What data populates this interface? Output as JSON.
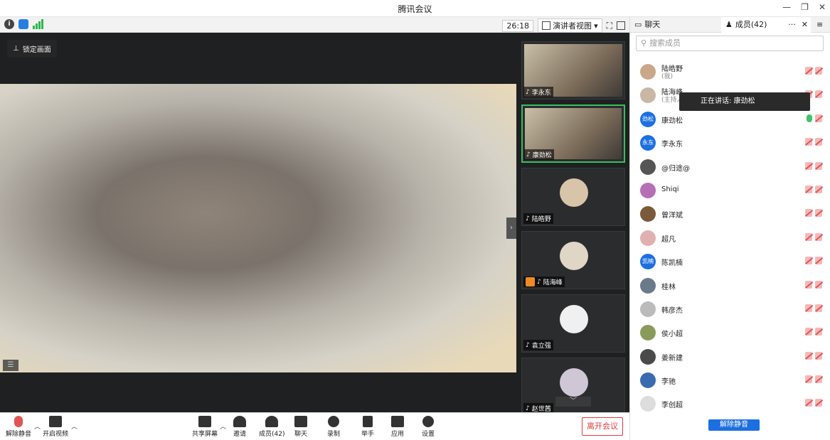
{
  "window": {
    "title": "腾讯会议"
  },
  "toolbar": {
    "timer": "26:18",
    "view_label": "演讲者视图"
  },
  "main": {
    "lock_label": "锁定画面"
  },
  "thumbnails": [
    {
      "name": "李永东",
      "type": "camera",
      "mic": "muted"
    },
    {
      "name": "康劲松",
      "type": "camera",
      "mic": "on",
      "active": true
    },
    {
      "name": "陆皓野",
      "type": "avatar",
      "mic": "muted"
    },
    {
      "name": "陆海峰",
      "type": "avatar",
      "mic": "muted",
      "host": true
    },
    {
      "name": "袁立强",
      "type": "avatar",
      "mic": "muted"
    },
    {
      "name": "赵世茜",
      "type": "avatar",
      "mic": "muted"
    }
  ],
  "bottombar": {
    "unmute": "解除静音",
    "start_video": "开启视频",
    "share_screen": "共享屏幕",
    "invite": "邀请",
    "members": "成员(42)",
    "chat": "聊天",
    "record": "录制",
    "raise_hand": "举手",
    "apps": "应用",
    "settings": "设置",
    "leave": "离开会议"
  },
  "panel": {
    "tab_chat": "聊天",
    "tab_members": "成员(42)",
    "search_placeholder": "搜索成员",
    "speaking_tooltip": "正在讲话: 康劲松",
    "unmute_button": "解除静音",
    "members": [
      {
        "name": "陆皓野",
        "sub": "(我)",
        "avatar": "",
        "color": "#c9a88a"
      },
      {
        "name": "陆海峰",
        "sub": "(主持人",
        "avatar": "",
        "color": "#c8b7a4"
      },
      {
        "name": "康劲松",
        "sub": "",
        "avatar": "劲松",
        "color": "#1c6fe0",
        "mic": "on"
      },
      {
        "name": "李永东",
        "sub": "",
        "avatar": "永东",
        "color": "#1c6fe0"
      },
      {
        "name": "@归途@",
        "sub": "",
        "avatar": "",
        "color": "#555"
      },
      {
        "name": "Shiqi",
        "sub": "",
        "avatar": "",
        "color": "#b56fb5"
      },
      {
        "name": "曾洋斌",
        "sub": "",
        "avatar": "",
        "color": "#7a5a3a"
      },
      {
        "name": "超凡",
        "sub": "",
        "avatar": "",
        "color": "#e0b0b0"
      },
      {
        "name": "陈凯楠",
        "sub": "",
        "avatar": "凯楠",
        "color": "#1c6fe0"
      },
      {
        "name": "桂林",
        "sub": "",
        "avatar": "",
        "color": "#6a7a8a"
      },
      {
        "name": "韩彦杰",
        "sub": "",
        "avatar": "",
        "color": "#bbb"
      },
      {
        "name": "侯小超",
        "sub": "",
        "avatar": "",
        "color": "#8a9a5a"
      },
      {
        "name": "姜新建",
        "sub": "",
        "avatar": "",
        "color": "#4a4a4a"
      },
      {
        "name": "李驰",
        "sub": "",
        "avatar": "",
        "color": "#3a6ab0"
      },
      {
        "name": "李创超",
        "sub": "",
        "avatar": "",
        "color": "#ddd"
      }
    ]
  }
}
